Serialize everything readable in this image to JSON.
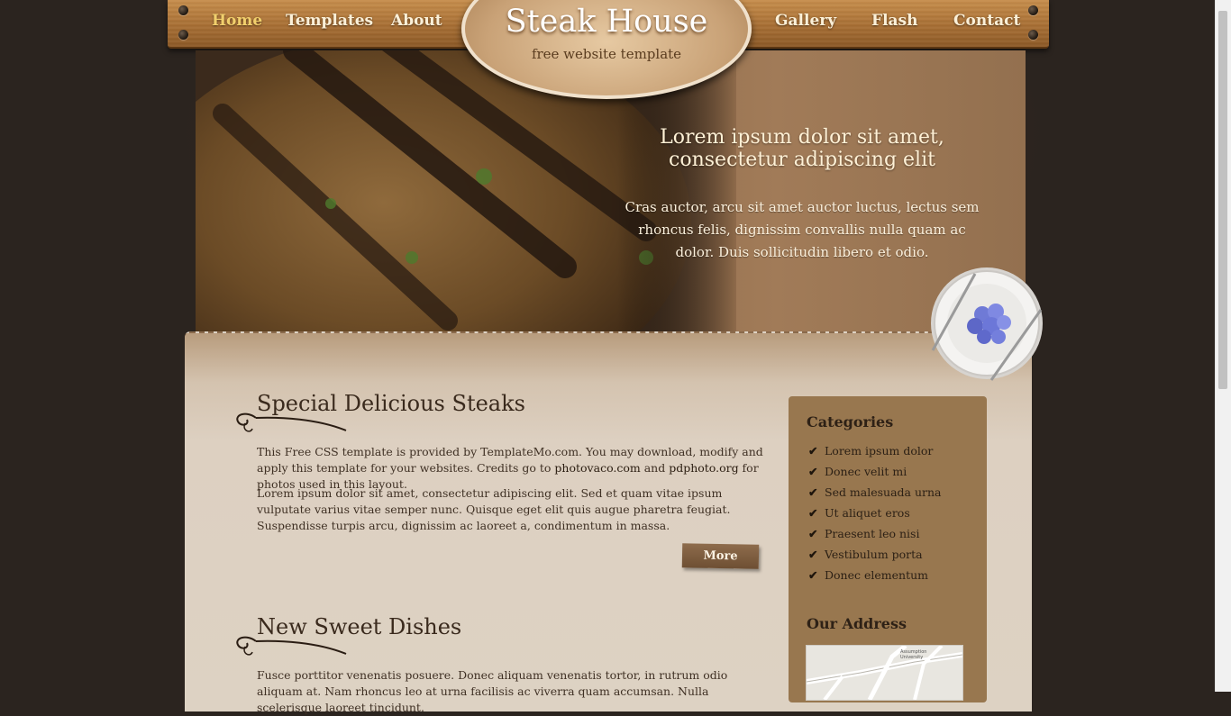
{
  "nav": {
    "items": [
      {
        "label": "Home",
        "active": true
      },
      {
        "label": "Templates",
        "active": false
      },
      {
        "label": "About",
        "active": false
      },
      {
        "label": "Gallery",
        "active": false
      },
      {
        "label": "Flash",
        "active": false
      },
      {
        "label": "Contact",
        "active": false
      }
    ]
  },
  "logo": {
    "title": "Steak House",
    "subtitle": "free website template"
  },
  "banner": {
    "title": "Lorem ipsum dolor sit amet, consectetur adipiscing elit",
    "text": "Cras auctor, arcu sit amet auctor luctus, lectus sem rhoncus felis, dignissim convallis nulla quam ac dolor. Duis sollicitudin libero et odio."
  },
  "sections": [
    {
      "title": "Special Delicious Steaks",
      "p1_before": "This Free CSS template is provided by TemplateMo.com. You may download, modify and apply this template for your websites. Credits go to ",
      "link1": "photovaco.com",
      "p1_mid": " and ",
      "link2": "pdphoto.org",
      "p1_after": " for photos used in this layout.",
      "p2": "Lorem ipsum dolor sit amet, consectetur adipiscing elit. Sed et quam vitae ipsum vulputate varius vitae semper nunc. Quisque eget elit quis augue pharetra feugiat. Suspendisse turpis arcu, dignissim ac laoreet a, condimentum in massa.",
      "more_label": "More"
    },
    {
      "title": "New Sweet Dishes",
      "p1": "Fusce porttitor venenatis posuere. Donec aliquam venenatis tortor, in rutrum odio aliquam at. Nam rhoncus leo at urna facilisis ac viverra quam accumsan. Nulla scelerisque laoreet tincidunt."
    }
  ],
  "sidebar": {
    "categories_title": "Categories",
    "categories": [
      "Lorem ipsum dolor",
      "Donec velit mi",
      "Sed malesuada urna",
      "Ut aliquet eros",
      "Praesent leo nisi",
      "Vestibulum porta",
      "Donec elementum"
    ],
    "address_title": "Our Address",
    "map_label": "Assumption University"
  },
  "colors": {
    "background": "#2b241f",
    "nav_active": "#f1cf6c",
    "nav_text": "#fbf0d8",
    "paper": "#ddd2c3",
    "sidebar": "#98774f"
  }
}
